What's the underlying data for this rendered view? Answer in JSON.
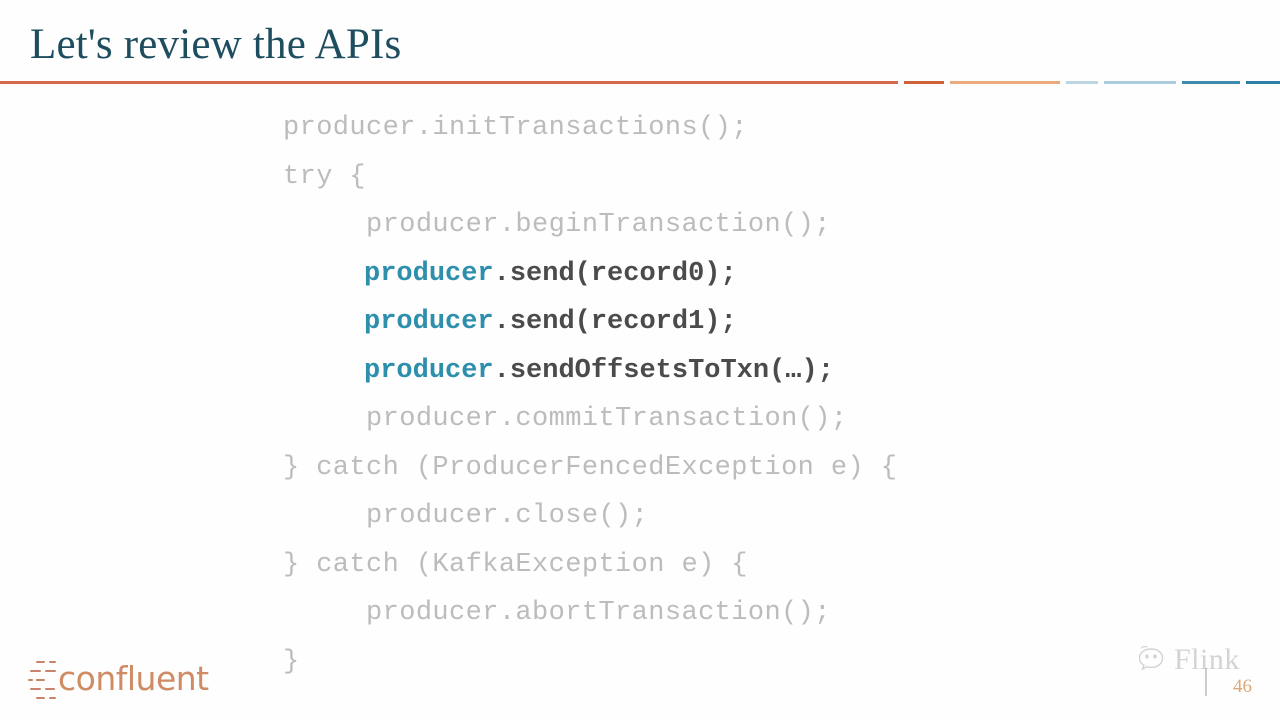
{
  "slide": {
    "title": "Let's review the APIs",
    "page_number": "46",
    "accent_orange": "#d3694a",
    "accent_teal": "#2e8fad",
    "title_color": "#1d4d5e",
    "code_dim_color": "#bcbcbc",
    "code_highlight_color": "#4b4b4b"
  },
  "header_rules": [
    {
      "name": "rule-main",
      "color": "#d3694a"
    },
    {
      "name": "rule-seg-a",
      "color": "#cf6239"
    },
    {
      "name": "rule-seg-b",
      "color": "#eba97c"
    },
    {
      "name": "rule-seg-c",
      "color": "#bdd6e2"
    },
    {
      "name": "rule-seg-d",
      "color": "#a9cdde"
    },
    {
      "name": "rule-seg-e",
      "color": "#3d8cb0"
    },
    {
      "name": "rule-seg-f",
      "color": "#2b7fa6"
    }
  ],
  "code": {
    "language": "java",
    "lines": [
      {
        "id": 1,
        "highlight": false,
        "text": "producer.initTransactions();"
      },
      {
        "id": 2,
        "highlight": false,
        "text": "try {"
      },
      {
        "id": 3,
        "highlight": false,
        "text": "     producer.beginTransaction();"
      },
      {
        "id": 4,
        "highlight": true,
        "indent": "     ",
        "object": "producer",
        "rest": ".send(record0);"
      },
      {
        "id": 5,
        "highlight": true,
        "indent": "     ",
        "object": "producer",
        "rest": ".send(record1);"
      },
      {
        "id": 6,
        "highlight": true,
        "indent": "     ",
        "object": "producer",
        "rest": ".sendOffsetsToTxn(…);"
      },
      {
        "id": 7,
        "highlight": false,
        "text": "     producer.commitTransaction();"
      },
      {
        "id": 8,
        "highlight": false,
        "text": "} catch (ProducerFencedException e) {"
      },
      {
        "id": 9,
        "highlight": false,
        "text": "     producer.close();"
      },
      {
        "id": 10,
        "highlight": false,
        "text": "} catch (KafkaException e) {"
      },
      {
        "id": 11,
        "highlight": false,
        "text": "     producer.abortTransaction();"
      },
      {
        "id": 12,
        "highlight": false,
        "text": "}"
      }
    ]
  },
  "branding": {
    "confluent_wordmark": "confluent",
    "confluent_color": "#cf8b63",
    "flink_wordmark": "Flink",
    "wechat_icon_name": "wechat-icon"
  }
}
